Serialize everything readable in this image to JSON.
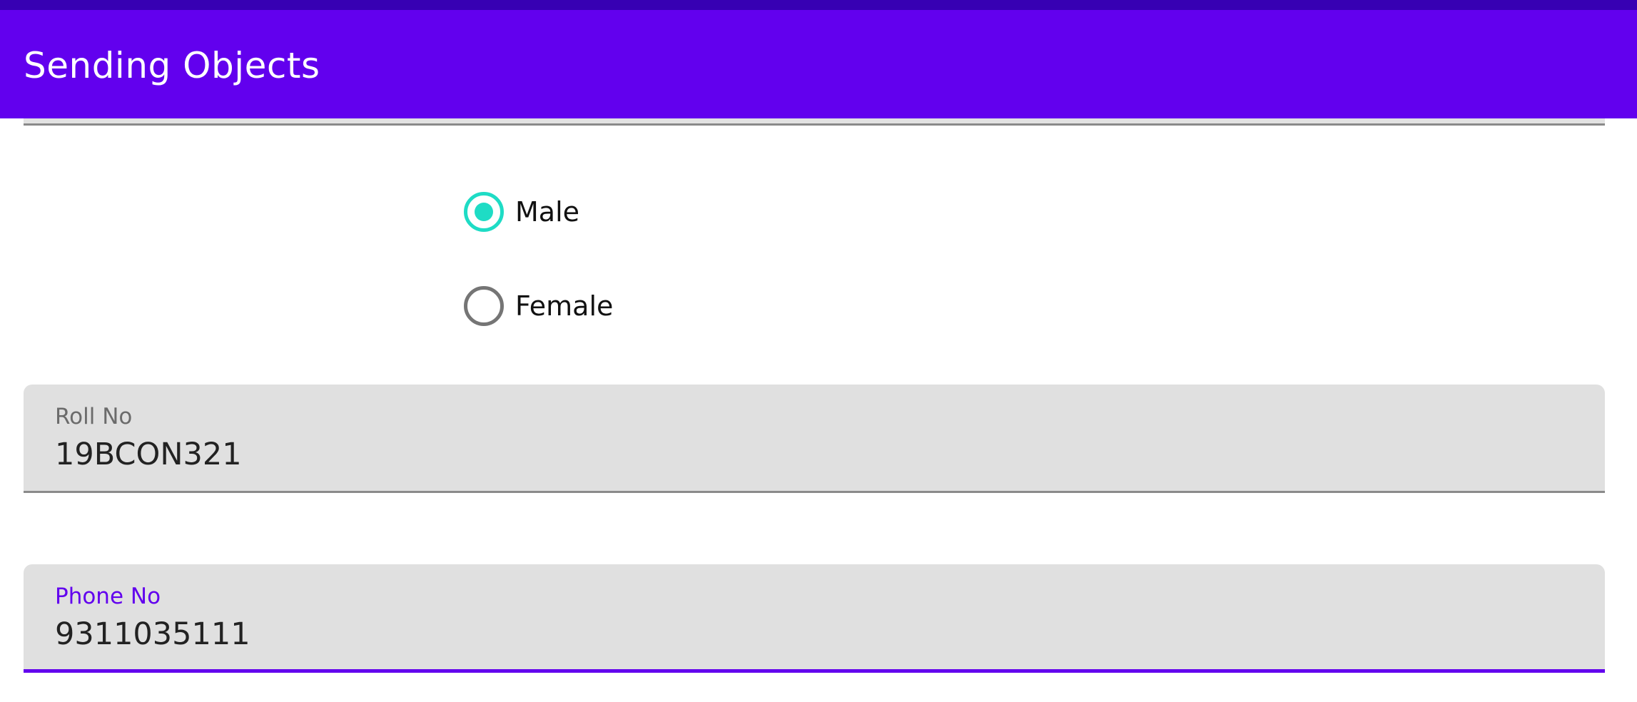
{
  "app_bar": {
    "title": "Sending Objects"
  },
  "gender": {
    "options": [
      {
        "label": "Male",
        "checked": true
      },
      {
        "label": "Female",
        "checked": false
      }
    ]
  },
  "fields": {
    "roll_no": {
      "label": "Roll No",
      "value": "19BCON321"
    },
    "phone_no": {
      "label": "Phone No",
      "value": "9311035111"
    }
  },
  "colors": {
    "status_bar": "#3700B3",
    "app_bar": "#6200EE",
    "radio_accent": "#1EDCC5",
    "focused_field_accent": "#6200EE"
  }
}
